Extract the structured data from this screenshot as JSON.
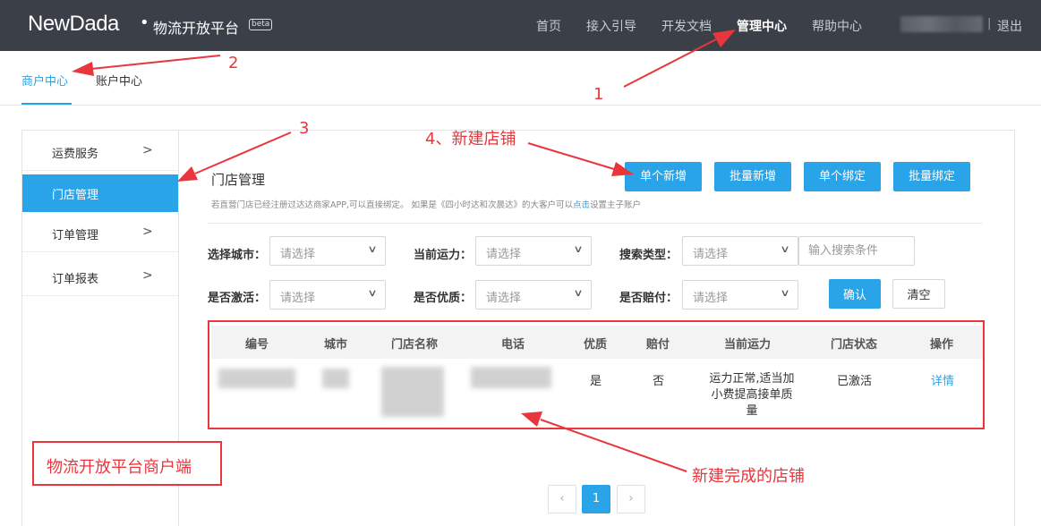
{
  "header": {
    "logo": "NewDada",
    "platform_name": "物流开放平台",
    "beta_badge": "beta",
    "nav": [
      "首页",
      "接入引导",
      "开发文档",
      "管理中心",
      "帮助中心"
    ],
    "active_nav": "管理中心",
    "separator": "|",
    "logout": "退出"
  },
  "tabs": {
    "merchant": "商户中心",
    "account": "账户中心"
  },
  "sidebar": {
    "items": [
      {
        "label": "运费服务",
        "chevron": ">"
      },
      {
        "label": "门店管理",
        "chevron": ""
      },
      {
        "label": "订单管理",
        "chevron": ">"
      },
      {
        "label": "订单报表",
        "chevron": ">"
      }
    ],
    "active_index": 1
  },
  "main": {
    "title": "门店管理",
    "buttons": [
      "单个新增",
      "批量新增",
      "单个绑定",
      "批量绑定"
    ],
    "hint_prefix": "若直营门店已经注册过达达商家APP,可以直接绑定。 如果是《四小时达和次晨达》的大客户可以",
    "hint_link": "点击",
    "hint_suffix": "设置主子账户"
  },
  "filters": {
    "city_label": "选择城市：",
    "capacity_label": "当前运力：",
    "search_type_label": "搜索类型：",
    "activated_label": "是否激活：",
    "premium_label": "是否优质：",
    "compensate_label": "是否赔付：",
    "select_placeholder": "请选择",
    "search_placeholder": "输入搜索条件",
    "confirm": "确认",
    "clear": "清空"
  },
  "table": {
    "headers": [
      "编号",
      "城市",
      "门店名称",
      "电话",
      "优质",
      "赔付",
      "当前运力",
      "门店状态",
      "操作"
    ],
    "rows": [
      {
        "premium": "是",
        "compensate": "否",
        "capacity_lines": [
          "运力正常,适当加",
          "小费提高接单质",
          "量"
        ],
        "status": "已激活",
        "action": "详情"
      }
    ]
  },
  "pagination": {
    "prev": "‹",
    "current": "1",
    "next": "›"
  },
  "annotations": {
    "n1": "1",
    "n2": "2",
    "n3": "3",
    "n4": "4、新建店铺",
    "new_store_done": "新建完成的店铺",
    "caption": "物流开放平台商户端"
  },
  "colors": {
    "accent": "#2aa4e8",
    "topbar": "#3b3f48",
    "annotation_red": "#e8363c"
  },
  "icons": [
    "chevron-right-icon",
    "dropdown-arrow-icon"
  ]
}
